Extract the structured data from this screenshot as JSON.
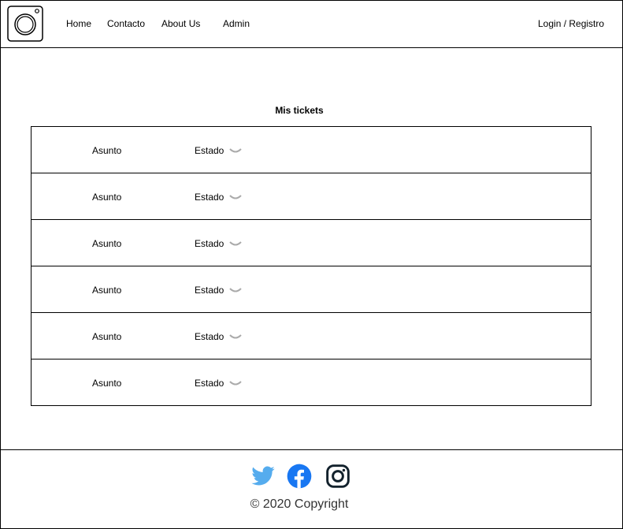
{
  "header": {
    "nav": [
      "Home",
      "Contacto",
      "About Us",
      "Admin"
    ],
    "login": "Login / Registro"
  },
  "main": {
    "title": "Mis tickets",
    "tickets": [
      {
        "asunto": "Asunto",
        "estado": "Estado"
      },
      {
        "asunto": "Asunto",
        "estado": "Estado"
      },
      {
        "asunto": "Asunto",
        "estado": "Estado"
      },
      {
        "asunto": "Asunto",
        "estado": "Estado"
      },
      {
        "asunto": "Asunto",
        "estado": "Estado"
      },
      {
        "asunto": "Asunto",
        "estado": "Estado"
      }
    ]
  },
  "footer": {
    "icons": [
      "twitter-icon",
      "facebook-icon",
      "instagram-icon"
    ],
    "copyright": "© 2020 Copyright"
  },
  "colors": {
    "twitter": "#55acee",
    "facebook": "#1877f2",
    "instagram": "#12212c",
    "chevron": "#aaaaaa"
  }
}
